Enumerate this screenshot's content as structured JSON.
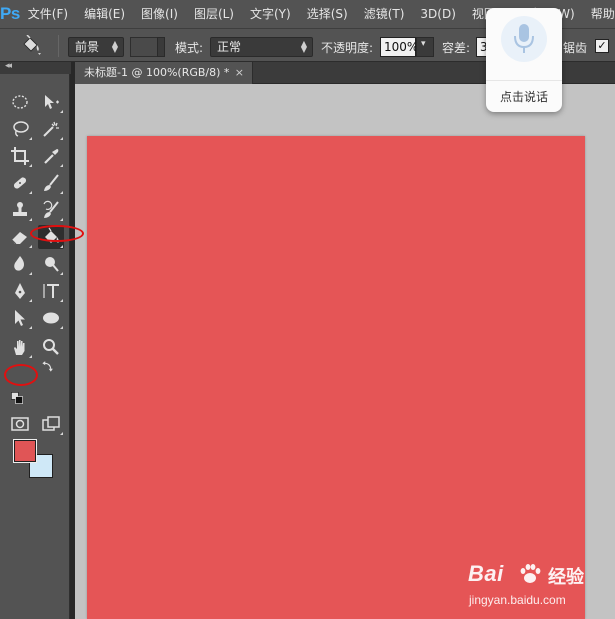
{
  "app": {
    "logo": "Ps",
    "accent": "#3fa9f5"
  },
  "menu": [
    "文件(F)",
    "编辑(E)",
    "图像(I)",
    "图层(L)",
    "文字(Y)",
    "选择(S)",
    "滤镜(T)",
    "3D(D)",
    "视图(V)",
    "窗口(W)",
    "帮助"
  ],
  "options": {
    "tool_icon": "paint-bucket-icon",
    "fill_source": "前景",
    "mode_label": "模式:",
    "mode_value": "正常",
    "opacity_label": "不透明度:",
    "opacity_value": "100%",
    "tolerance_label": "容差:",
    "tolerance_value": "3",
    "antialias_label": "锯齿",
    "antialias_checked": true
  },
  "document": {
    "tab_title": "未标题-1 @ 100%(RGB/8) *",
    "close_glyph": "×",
    "canvas_color": "#e55556",
    "pasteboard_color": "#c3c3c3"
  },
  "toolbox": {
    "collapse_glyph": "◂◂",
    "tools": [
      "rectangular-marquee-icon",
      "move-icon",
      "lasso-icon",
      "magic-wand-icon",
      "crop-icon",
      "eyedropper-icon",
      "healing-brush-icon",
      "brush-icon",
      "clone-stamp-icon",
      "history-brush-icon",
      "eraser-icon",
      "paint-bucket-icon",
      "blur-icon",
      "dodge-icon",
      "pen-icon",
      "type-icon",
      "path-selection-icon",
      "ellipse-icon",
      "hand-icon",
      "zoom-icon"
    ],
    "active_tool": "paint-bucket-icon",
    "foreground_color": "#e05556",
    "background_color": "#cfe8f7"
  },
  "voice": {
    "label": "点击说话",
    "icon": "microphone-icon"
  },
  "watermark": {
    "brand": "Bai",
    "brand2": "经验",
    "url": "jingyan.baidu.com",
    "icon": "paw-icon"
  },
  "annotations": {
    "color": "#e01010"
  }
}
